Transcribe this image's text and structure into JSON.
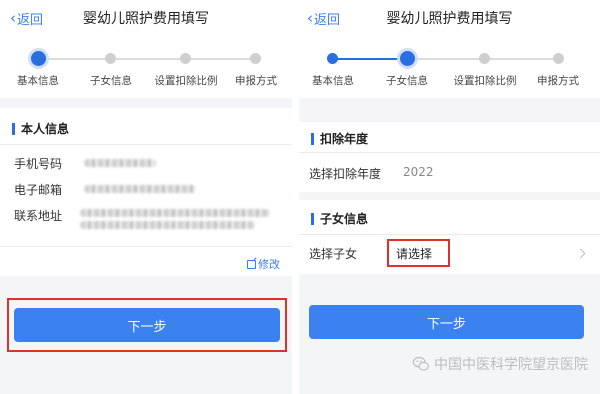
{
  "left": {
    "back_label": "返回",
    "title": "婴幼儿照护费用填写",
    "steps": [
      "基本信息",
      "子女信息",
      "设置扣除比例",
      "申报方式"
    ],
    "section_title": "本人信息",
    "fields": [
      {
        "label": "手机号码"
      },
      {
        "label": "电子邮箱"
      },
      {
        "label": "联系地址"
      }
    ],
    "edit_label": "修改",
    "next_label": "下一步"
  },
  "right": {
    "back_label": "返回",
    "title": "婴幼儿照护费用填写",
    "steps": [
      "基本信息",
      "子女信息",
      "设置扣除比例",
      "申报方式"
    ],
    "year_section_title": "扣除年度",
    "year_label": "选择扣除年度",
    "year_value": "2022",
    "child_section_title": "子女信息",
    "child_label": "选择子女",
    "child_value": "请选择",
    "next_label": "下一步"
  },
  "watermark": "中国中医科学院望京医院",
  "colors": {
    "accent": "#3b82f0",
    "highlight": "#e0302a"
  }
}
